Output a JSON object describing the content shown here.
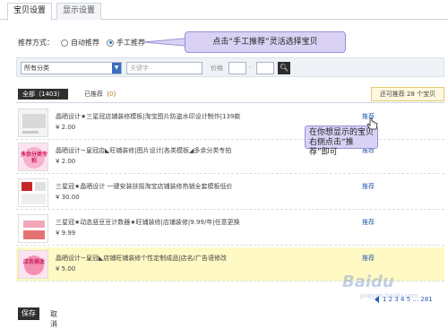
{
  "tabs": [
    {
      "label": "宝贝设置",
      "active": true
    },
    {
      "label": "显示设置",
      "active": false
    }
  ],
  "recommend": {
    "label": "推荐方式：",
    "options": [
      {
        "label": "自动推荐",
        "checked": false
      },
      {
        "label": "手工推荐",
        "checked": true
      }
    ]
  },
  "callout_top": "点击“手工推荐”灵活选择宝贝",
  "filter": {
    "category": "所有分类",
    "keyword_placeholder": "关键字",
    "price_label": "价格",
    "price_sep": "-"
  },
  "list_tabs": {
    "all_label": "全部",
    "all_count": "1403",
    "selected_label": "已推荐",
    "selected_count": "0"
  },
  "quota": "还可推荐 28 个宝贝",
  "items": [
    {
      "title": "晶晒设计★三星冠店铺装修模板|淘宝图片防盗水印设计制作|139款",
      "price": "¥ 2.00",
      "action": "推荐",
      "highlight": false
    },
    {
      "title": "晶晒设计~皇冠店◣旺铺装修|图片设计|各类模板◢多余分类专拍",
      "price": "¥ 2.00",
      "action": "推荐",
      "highlight": false,
      "thumb_text": "多余分类专拍"
    },
    {
      "title": "三星冠★晶晒设计 一键安装扶摇淘宝店铺装修热销全套模板低价",
      "price": "¥ 30.00",
      "action": "推荐",
      "highlight": false
    },
    {
      "title": "三星冠★动态竖豆豆计数器★旺铺装修|店铺装修|9.99/年|任意更换",
      "price": "¥ 9.99",
      "action": "推荐",
      "highlight": false
    },
    {
      "title": "晶晒设计~皇冠◣店铺旺铺装修个性定制成品|店名/广告语修改",
      "price": "¥ 5.00",
      "action": "推荐",
      "highlight": true,
      "thumb_text": "店名修改"
    }
  ],
  "callout_side": "在你想显示的宝贝右侧点击“推荐”即可",
  "pager": {
    "pages": "1 2 3 4 5 ... 281"
  },
  "bottom": {
    "save": "保存",
    "cancel": "取消"
  },
  "watermark": {
    "main": "Baidu",
    "sub": "jingyan.baidu.com"
  },
  "colors": {
    "accent": "#2a5db0",
    "callout": "#d9d2f4",
    "highlight": "#fff9c4"
  }
}
